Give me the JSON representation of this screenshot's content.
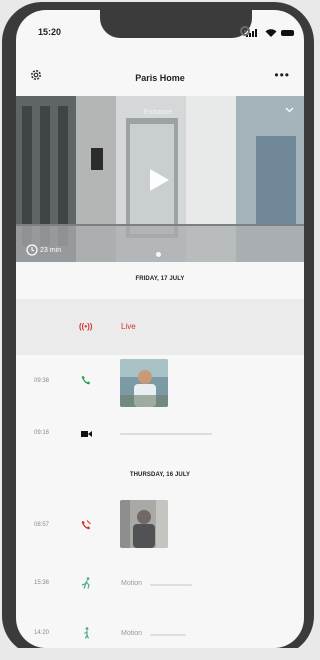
{
  "status": {
    "time": "15:20"
  },
  "header": {
    "title": "Paris Home"
  },
  "video": {
    "camera_label": "Entrance",
    "duration": "23 min"
  },
  "days": [
    {
      "label": "FRIDAY, 17 JULY"
    },
    {
      "label": "THURSDAY, 16 JULY"
    }
  ],
  "live": {
    "icon_text": "((•))",
    "label": "Live"
  },
  "events": [
    {
      "time": "09:38",
      "type": "call-answered",
      "color": "#2e9e4f"
    },
    {
      "time": "09:16",
      "type": "recording",
      "color": "#111111"
    },
    {
      "time": "08:57",
      "type": "call-missed",
      "color": "#d32f2f"
    },
    {
      "time": "15:36",
      "type": "motion",
      "label": "Motion",
      "color": "#4fae8f"
    },
    {
      "time": "14:20",
      "type": "motion",
      "label": "Motion",
      "color": "#4fae8f"
    }
  ]
}
